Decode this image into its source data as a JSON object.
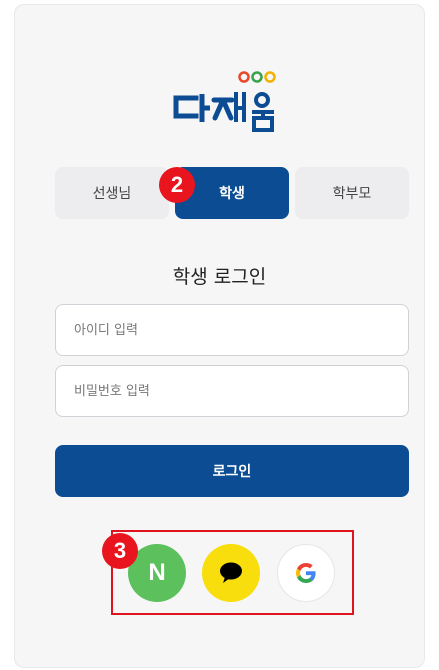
{
  "logo": {
    "text": "다채움"
  },
  "tabs": [
    {
      "label": "선생님",
      "active": false
    },
    {
      "label": "학생",
      "active": true
    },
    {
      "label": "학부모",
      "active": false
    }
  ],
  "annotations": {
    "step2": "2",
    "step3": "3"
  },
  "login": {
    "title": "학생 로그인",
    "id_placeholder": "아이디 입력",
    "pw_placeholder": "비밀번호 입력",
    "button_label": "로그인"
  },
  "social": {
    "naver_letter": "N",
    "icons": [
      "naver-icon",
      "kakao-icon",
      "google-icon"
    ]
  },
  "colors": {
    "primary": "#0b4c93",
    "annotation_red": "#e8141e",
    "naver_green": "#5cc15d",
    "kakao_yellow": "#f7de0c"
  }
}
